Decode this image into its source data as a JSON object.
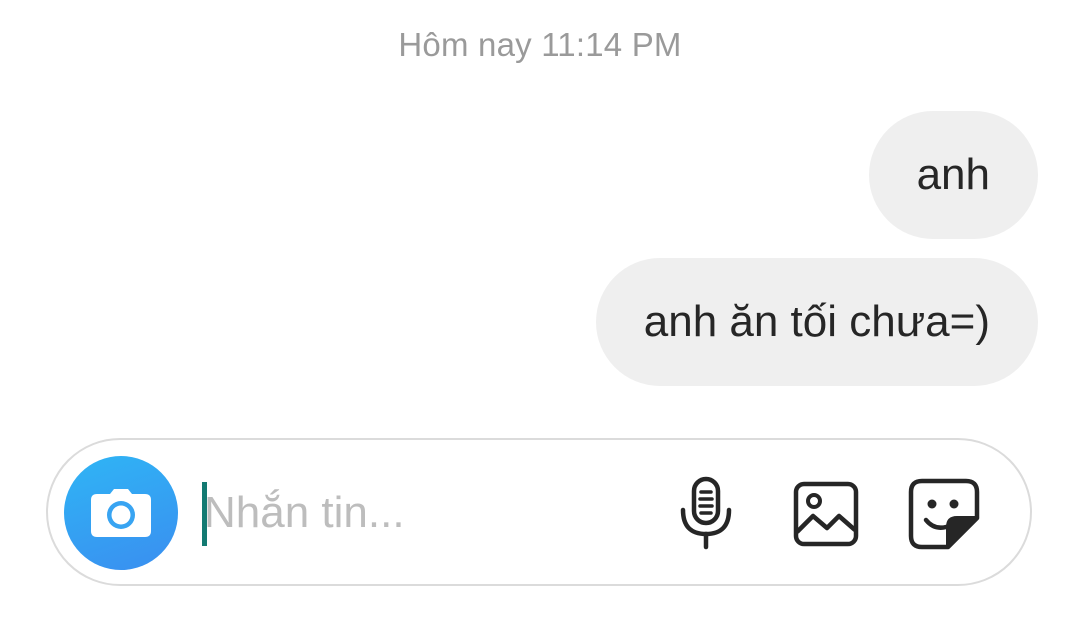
{
  "thread": {
    "timestamp": "Hôm nay 11:14 PM",
    "messages": [
      {
        "text": "anh",
        "sender": "me"
      },
      {
        "text": "anh ăn tối chưa=)",
        "sender": "me"
      }
    ]
  },
  "composer": {
    "placeholder": "Nhắn tin...",
    "value": "",
    "icons": {
      "camera": "camera-icon",
      "mic": "microphone-icon",
      "gallery": "image-gallery-icon",
      "sticker": "sticker-icon"
    }
  },
  "colors": {
    "bubble_bg": "#efefef",
    "camera_gradient_start": "#2fb5f5",
    "camera_gradient_end": "#3a8ef0",
    "caret": "#137a72",
    "timestamp": "#9a9a9a",
    "placeholder": "#bdbdbd"
  }
}
